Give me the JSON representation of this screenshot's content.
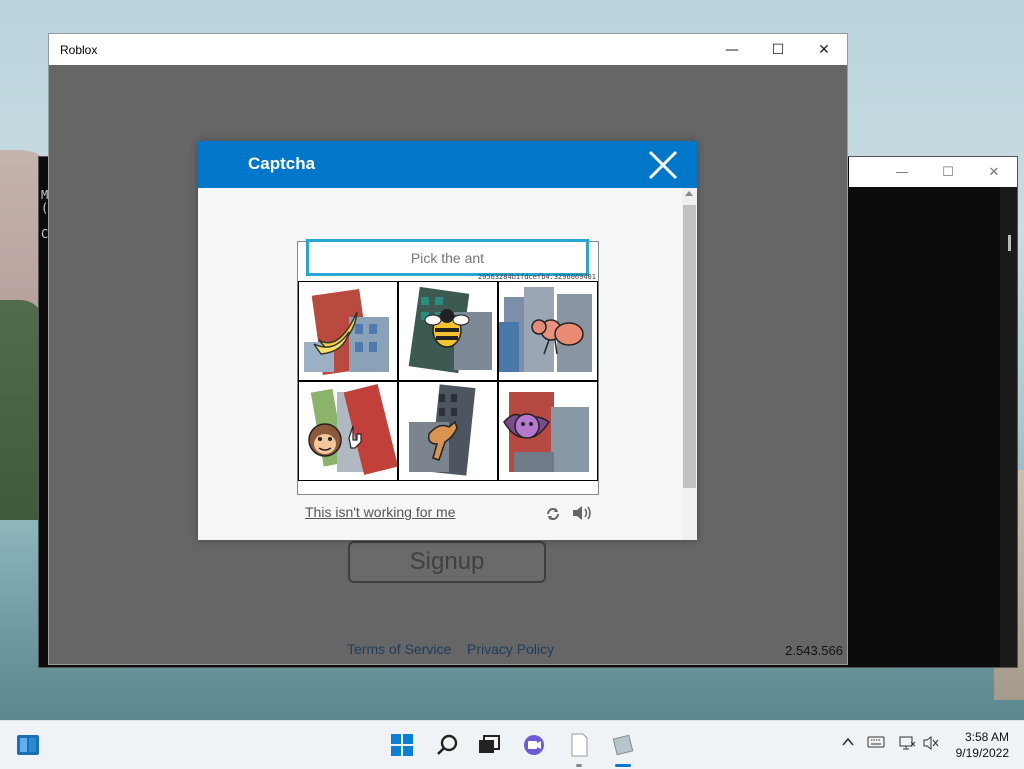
{
  "console_window": {
    "text_lines": [
      "M",
      "(",
      "",
      "C"
    ],
    "controls": [
      "—",
      "☐",
      "✕"
    ]
  },
  "roblox_window": {
    "title": "Roblox",
    "controls": {
      "minimize": "—",
      "maximize": "☐",
      "close": "✕"
    },
    "signup_label": "Signup",
    "terms_label": "Terms of Service",
    "privacy_label": "Privacy Policy",
    "version": "2.543.566"
  },
  "captcha": {
    "title": "Captcha",
    "prompt": "Pick the ant",
    "session_id": "20563284b1fdcefb4.3296069401",
    "tiles": [
      {
        "icon": "banana-building-icon"
      },
      {
        "icon": "bee-building-icon"
      },
      {
        "icon": "ant-building-icon"
      },
      {
        "icon": "monkey-building-icon"
      },
      {
        "icon": "kangaroo-building-icon"
      },
      {
        "icon": "bat-building-icon"
      }
    ],
    "not_working_label": "This isn't working for me",
    "accent": "#0077c8"
  },
  "taskbar": {
    "pinned": [
      "widgets-icon",
      "start-icon",
      "search-icon",
      "task-view-icon",
      "chat-icon",
      "notepad-icon",
      "roblox-icon"
    ],
    "clock_time": "3:58 AM",
    "clock_date": "9/19/2022"
  }
}
